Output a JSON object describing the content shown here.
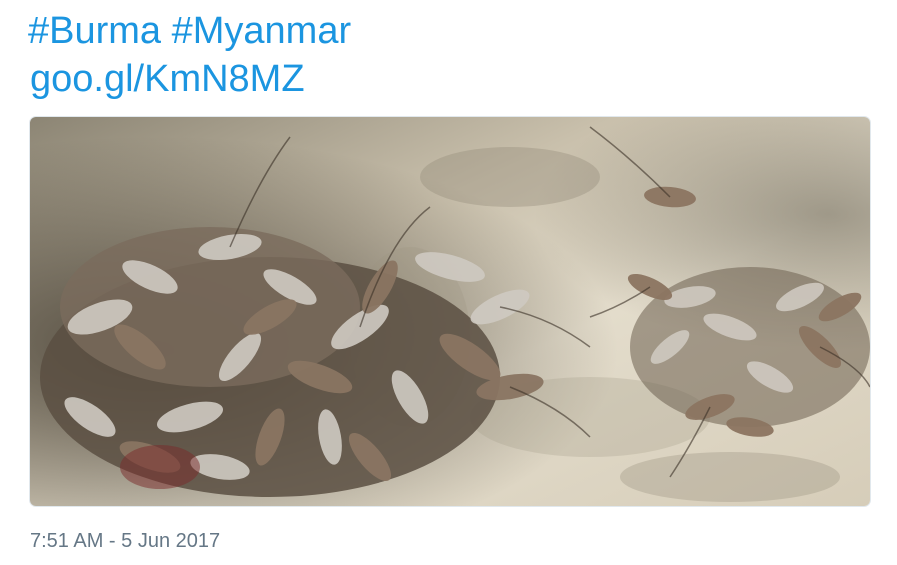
{
  "tweet": {
    "partial_text_above": "",
    "hashtags": [
      "#Burma",
      "#Myanmar"
    ],
    "link": "goo.gl/KmN8MZ",
    "timestamp": "7:51 AM - 5 Jun 2017",
    "colors": {
      "link": "#1b95e0",
      "text": "#14171a",
      "meta": "#657786",
      "border": "#e1e8ed"
    }
  }
}
